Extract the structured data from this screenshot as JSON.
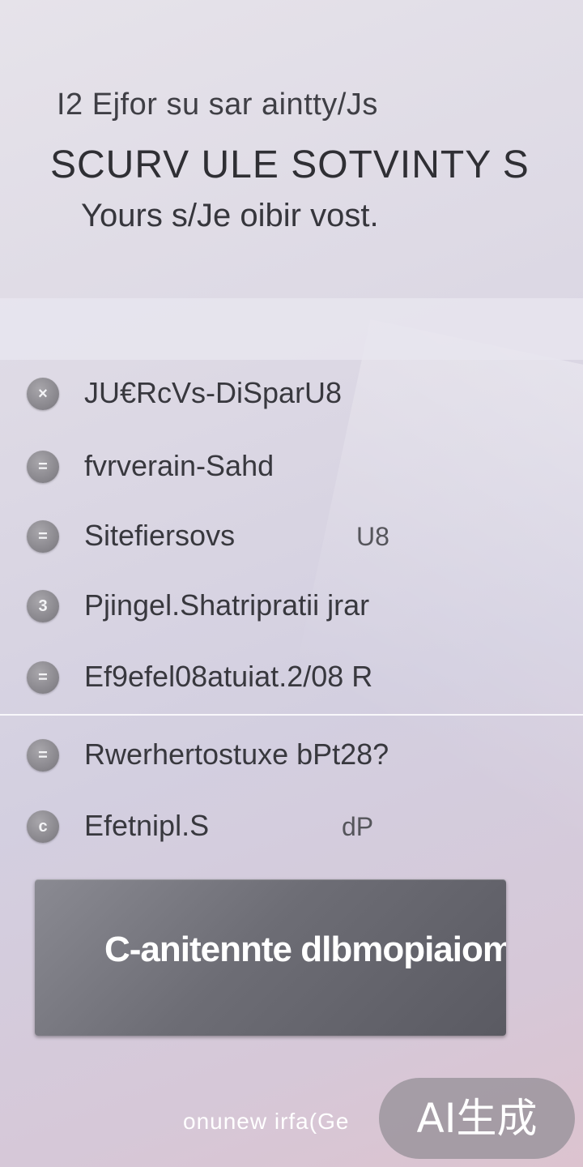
{
  "header": {
    "eyebrow": "I2 Ejfor su sar aintty/Js",
    "title": "SCURV ULE SOTVINTY  S",
    "subtitle": "Yours s/Je oibir vost."
  },
  "menu": {
    "items": [
      {
        "icon": "x-icon",
        "glyph": "×",
        "label": "JU€RcVs-DiSparU8",
        "value": ""
      },
      {
        "icon": "equals-icon",
        "glyph": "=",
        "label": "fvrverain-Sahd",
        "value": ""
      },
      {
        "icon": "equals-icon",
        "glyph": "=",
        "label": "Sitefiersovs",
        "value": "U8"
      },
      {
        "icon": "number-3-icon",
        "glyph": "3",
        "label": "Pjingel.Shatripratii jrar",
        "value": ""
      },
      {
        "icon": "equals-icon",
        "glyph": "=",
        "label": "Ef9efel08atuiat.2/08 R",
        "value": ""
      },
      {
        "icon": "equals-icon",
        "glyph": "=",
        "label": "Rwerhertostuxe bPt28?",
        "value": ""
      },
      {
        "icon": "c-icon",
        "glyph": "c",
        "label": "Efetnipl.S",
        "value": "dP"
      }
    ]
  },
  "cta": {
    "label": "C-anitennte dlbmopiaiom"
  },
  "footer": {
    "link": "onunew  irfa(Ge"
  },
  "watermark": {
    "text": "AI生成"
  },
  "colors": {
    "background": "#dcd8e4",
    "button": "#6d6d75",
    "bullet": "#86848a",
    "text": "#38383e"
  }
}
